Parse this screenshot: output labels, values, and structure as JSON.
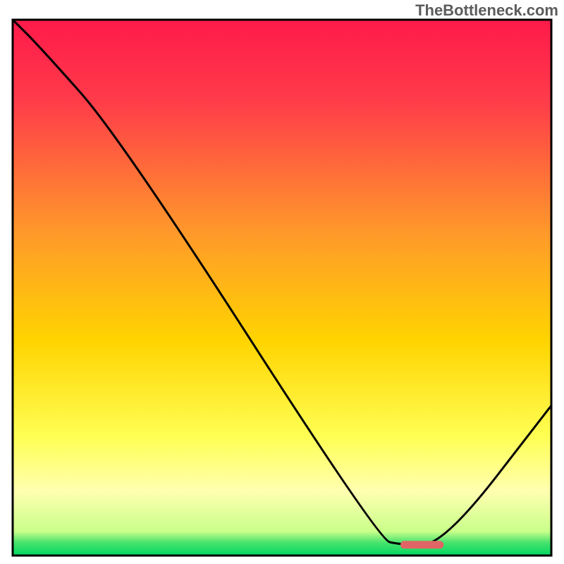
{
  "watermark": "TheBottleneck.com",
  "chart_data": {
    "type": "line",
    "title": "",
    "xlabel": "",
    "ylabel": "",
    "xlim": [
      0,
      100
    ],
    "ylim": [
      0,
      100
    ],
    "x": [
      0,
      5,
      20,
      68,
      72,
      80,
      100
    ],
    "y": [
      100,
      95,
      78,
      3,
      2,
      2,
      28
    ],
    "marker": {
      "x_start": 72,
      "x_end": 80,
      "y": 2
    },
    "gradient_stops": [
      {
        "offset": 0.0,
        "color": "#ff1a4a"
      },
      {
        "offset": 0.15,
        "color": "#ff3b4a"
      },
      {
        "offset": 0.4,
        "color": "#ff9a2a"
      },
      {
        "offset": 0.6,
        "color": "#ffd400"
      },
      {
        "offset": 0.78,
        "color": "#ffff55"
      },
      {
        "offset": 0.88,
        "color": "#ffffb0"
      },
      {
        "offset": 0.955,
        "color": "#c9ff8a"
      },
      {
        "offset": 0.975,
        "color": "#4be36e"
      },
      {
        "offset": 1.0,
        "color": "#00d860"
      }
    ],
    "line_color": "#000000",
    "marker_color": "#e06666",
    "frame_color": "#000000"
  }
}
